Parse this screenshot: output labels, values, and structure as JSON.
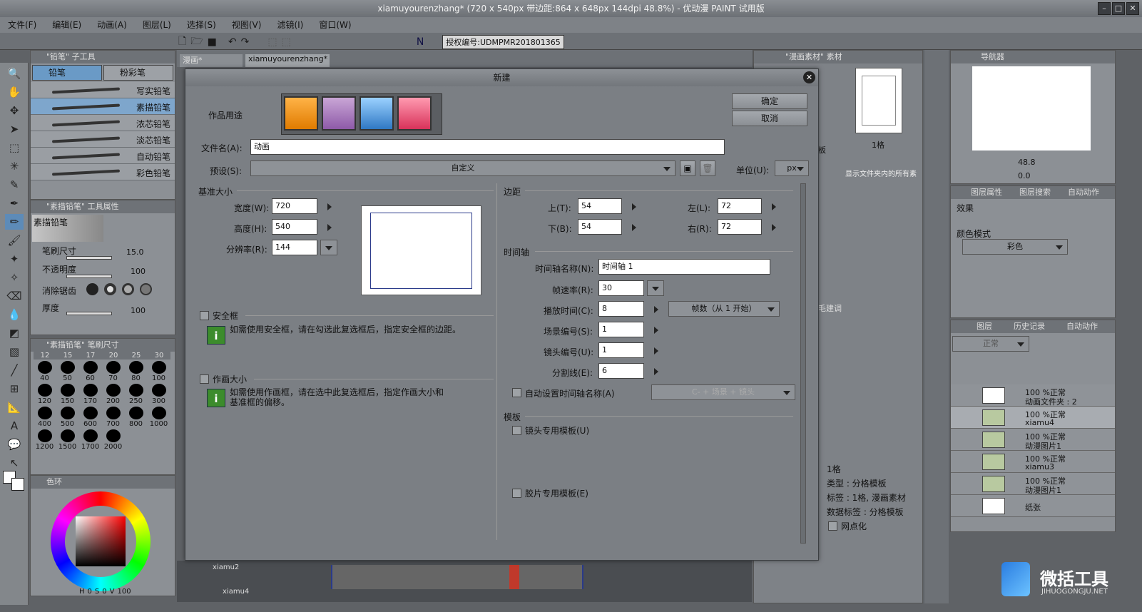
{
  "app": {
    "title": "xiamuyourenzhang* (720 x 540px 带边距:864 x 648px 144dpi 48.8%) - 优动漫 PAINT 试用版"
  },
  "menu": [
    "文件(F)",
    "编辑(E)",
    "动画(A)",
    "图层(L)",
    "选择(S)",
    "视图(V)",
    "滤镜(I)",
    "窗口(W)"
  ],
  "toolbar": {
    "license": "授权编号:UDMPMR201801365"
  },
  "doc_tabs": [
    "漫画*",
    "xiamuyourenzhang*"
  ],
  "subtool": {
    "header": "\"铅笔\" 子工具",
    "tab1": "铅笔",
    "tab2": "粉彩笔",
    "brushes": [
      "写实铅笔",
      "素描铅笔",
      "浓芯铅笔",
      "淡芯铅笔",
      "自动铅笔",
      "彩色铅笔"
    ]
  },
  "toolprops": {
    "header": "\"素描铅笔\" 工具属性",
    "name": "素描铅笔",
    "size_label": "笔刷尺寸",
    "size_val": "15.0",
    "opacity_label": "不透明度",
    "opacity_val": "100",
    "aa_label": "消除锯齿",
    "thick_label": "厚度",
    "thick_val": "100"
  },
  "brushsize": {
    "header": "\"素描铅笔\" 笔刷尺寸",
    "top": [
      "12",
      "15",
      "17",
      "20",
      "25",
      "30"
    ],
    "sizes": [
      "40",
      "50",
      "60",
      "70",
      "80",
      "100",
      "120",
      "150",
      "170",
      "200",
      "250",
      "300",
      "400",
      "500",
      "600",
      "700",
      "800",
      "1000",
      "1200",
      "1500",
      "1700",
      "2000"
    ]
  },
  "color": {
    "header": "色环",
    "h": "H",
    "hv": "0",
    "s": "S",
    "sv": "0",
    "v": "V",
    "vv": "100"
  },
  "dialog": {
    "title": "新建",
    "use_label": "作品用途",
    "ok": "确定",
    "cancel": "取消",
    "filename_label": "文件名(A):",
    "filename": "动画",
    "preset_label": "预设(S):",
    "preset": "自定义",
    "unit_label": "单位(U):",
    "unit": "px",
    "base_title": "基准大小",
    "width_label": "宽度(W):",
    "width": "720",
    "height_label": "高度(H):",
    "height": "540",
    "res_label": "分辨率(R):",
    "res": "144",
    "margin_title": "边距",
    "top_label": "上(T):",
    "top": "54",
    "bottom_label": "下(B):",
    "bottom": "54",
    "left_label": "左(L):",
    "left": "72",
    "right_label": "右(R):",
    "right": "72",
    "timeline_title": "时间轴",
    "tl_name_label": "时间轴名称(N):",
    "tl_name": "时间轴 1",
    "fps_label": "帧速率(R):",
    "fps": "30",
    "play_label": "播放时间(C):",
    "play": "8",
    "frames_sel": "帧数（从 1 开始）",
    "scene_label": "场景编号(S):",
    "scene": "1",
    "cut_label": "镜头编号(U):",
    "cut": "1",
    "div_label": "分割线(E):",
    "div": "6",
    "auto_label": "自动设置时间轴名称(A)",
    "auto_sel": "C- + 场景 + 镜头",
    "safe_label": "安全框",
    "safe_note": "如需使用安全框，请在勾选此复选框后，指定安全框的边距。",
    "frame_label": "作画大小",
    "frame_note": "如需使用作画框，请在选中此复选框后，指定作画大小和基准框的偏移。",
    "tmpl_title": "模板",
    "tmpl1": "镜头专用模板(U)",
    "tmpl2": "胶片专用模板(E)"
  },
  "material": {
    "header": "\"漫画素材\" 素材",
    "thumb_label": "1格",
    "desc": "显示文件夹内的所有素",
    "name": "1格",
    "type": "类型 : 分格模板",
    "tag": "标签 : 1格, 漫画素材",
    "datatag": "数据标签 : 分格模板",
    "halftone": "网点化",
    "side1": "板",
    "side2": "毛建调"
  },
  "navigator": {
    "header": "导航器",
    "zoom": "48.8",
    "angle": "0.0"
  },
  "layerprops": {
    "header": "图层属性",
    "header2": "图层搜索",
    "header3": "自动动作",
    "effect": "效果",
    "colormode": "颜色模式",
    "colormode_val": "彩色"
  },
  "layers": {
    "header": "图层",
    "header2": "历史记录",
    "header3": "自动动作",
    "blend": "正常",
    "items": [
      {
        "l1": "100 %正常",
        "l2": "动画文件夹 : 2"
      },
      {
        "l1": "100 %正常",
        "l2": "xiamu4"
      },
      {
        "l1": "100 %正常",
        "l2": "动漫图片1"
      },
      {
        "l1": "100 %正常",
        "l2": "xiamu3"
      },
      {
        "l1": "100 %正常",
        "l2": "动漫图片1"
      },
      {
        "l1": "",
        "l2": "纸张"
      }
    ]
  },
  "timeline": {
    "t1": "xiamu2",
    "t2": "xiamu4"
  },
  "watermark": {
    "text": "微括工具",
    "sub": "JIHUOGONGJU.NET"
  }
}
